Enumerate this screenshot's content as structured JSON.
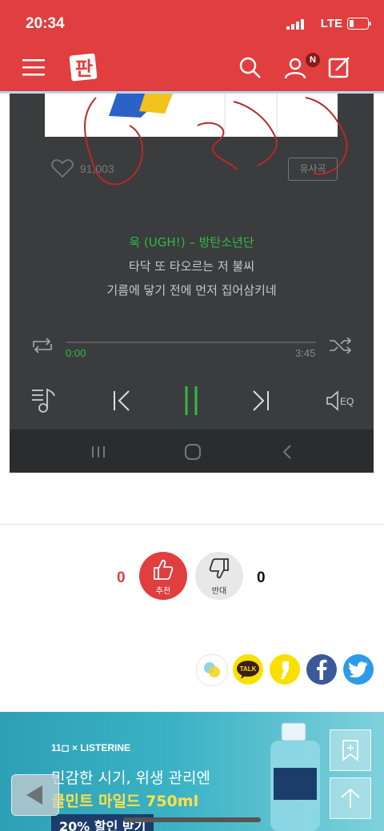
{
  "status_bar": {
    "time": "20:34",
    "network": "LTE"
  },
  "header": {
    "logo_text": "판",
    "notification_badge": "N"
  },
  "player": {
    "like_count": "91,003",
    "similar_button": "유사곡",
    "song_title": "욱 (UGH!) – 방탄소년단",
    "lyrics": [
      "타닥 또 타오르는 저 불씨",
      "기름에 닿기 전에 먼저 집어삼키네"
    ],
    "current_time": "0:00",
    "total_time": "3:45",
    "progress": 0,
    "eq_label": "EQ"
  },
  "votes": {
    "up_count": "0",
    "up_label": "추천",
    "down_label": "반대",
    "down_count": "0"
  },
  "share": {
    "kakaotalk_label": "TALK"
  },
  "ad": {
    "brand": "11◻ × LISTERINE",
    "line1": "민감한 시기, 위생 관리엔",
    "line2": "쿨민트 마일드 750ml",
    "line3": "20% 할인 받기"
  },
  "colors": {
    "brand_red": "#e03e3f",
    "player_green": "#2cbd44",
    "facebook": "#3b5998",
    "twitter": "#1da1f2",
    "kakao": "#f9e000"
  }
}
